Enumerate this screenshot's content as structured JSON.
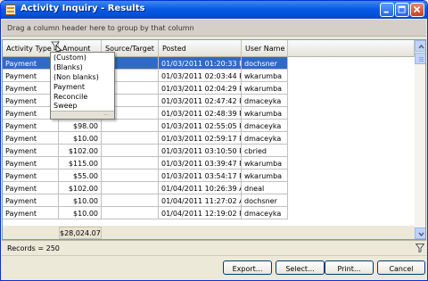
{
  "window": {
    "title": "Activity Inquiry - Results"
  },
  "group_panel": {
    "text": "Drag a column header here to group by that column"
  },
  "columns": [
    {
      "label": "Activity Type"
    },
    {
      "label": "Amount"
    },
    {
      "label": "Source/Target"
    },
    {
      "label": "Posted"
    },
    {
      "label": "User Name"
    }
  ],
  "rows": [
    {
      "type": "Payment",
      "amount": "",
      "source": "",
      "posted": "01/03/2011 01:20:33 PM",
      "user": "dochsner"
    },
    {
      "type": "Payment",
      "amount": "",
      "source": "",
      "posted": "01/03/2011 02:03:44 PM",
      "user": "wkarumba"
    },
    {
      "type": "Payment",
      "amount": "",
      "source": "",
      "posted": "01/03/2011 02:04:29 PM",
      "user": "wkarumba"
    },
    {
      "type": "Payment",
      "amount": "",
      "source": "",
      "posted": "01/03/2011 02:47:42 PM",
      "user": "dmaceyka"
    },
    {
      "type": "Payment",
      "amount": "",
      "source": "",
      "posted": "01/03/2011 02:48:39 PM",
      "user": "wkarumba"
    },
    {
      "type": "Payment",
      "amount": "$98.00",
      "source": "",
      "posted": "01/03/2011 02:55:05 PM",
      "user": "dmaceyka"
    },
    {
      "type": "Payment",
      "amount": "$10.00",
      "source": "",
      "posted": "01/03/2011 02:59:17 PM",
      "user": "dmaceyka"
    },
    {
      "type": "Payment",
      "amount": "$102.00",
      "source": "",
      "posted": "01/03/2011 03:10:50 PM",
      "user": "cbried"
    },
    {
      "type": "Payment",
      "amount": "$115.00",
      "source": "",
      "posted": "01/03/2011 03:39:47 PM",
      "user": "wkarumba"
    },
    {
      "type": "Payment",
      "amount": "$55.00",
      "source": "",
      "posted": "01/03/2011 03:54:17 PM",
      "user": "wkarumba"
    },
    {
      "type": "Payment",
      "amount": "$102.00",
      "source": "",
      "posted": "01/04/2011 10:26:39 AM",
      "user": "dneal"
    },
    {
      "type": "Payment",
      "amount": "$10.00",
      "source": "",
      "posted": "01/04/2011 11:27:02 AM",
      "user": "dochsner"
    },
    {
      "type": "Payment",
      "amount": "$10.00",
      "source": "",
      "posted": "01/04/2011 12:19:02 PM",
      "user": "dmaceyka"
    }
  ],
  "summary": {
    "total": "$28,024.07"
  },
  "filter_popup": {
    "items": [
      "(Custom)",
      "(Blanks)",
      "(Non blanks)",
      "Payment",
      "Reconcile",
      "Sweep"
    ],
    "grip": "..."
  },
  "status": {
    "records": "Records = 250"
  },
  "buttons": {
    "export": "Export...",
    "select": "Select...",
    "print": "Print...",
    "cancel": "Cancel"
  },
  "colors": {
    "selection": "#316ac5",
    "titlebar": "#0a5ae6",
    "window_bg": "#ece9d8"
  },
  "icons": {
    "app": "report-icon",
    "filter_active": "filter-funnel-icon",
    "status_filter": "funnel-icon"
  },
  "state": {
    "selected_row": 0,
    "scroll_position": 0.0
  }
}
